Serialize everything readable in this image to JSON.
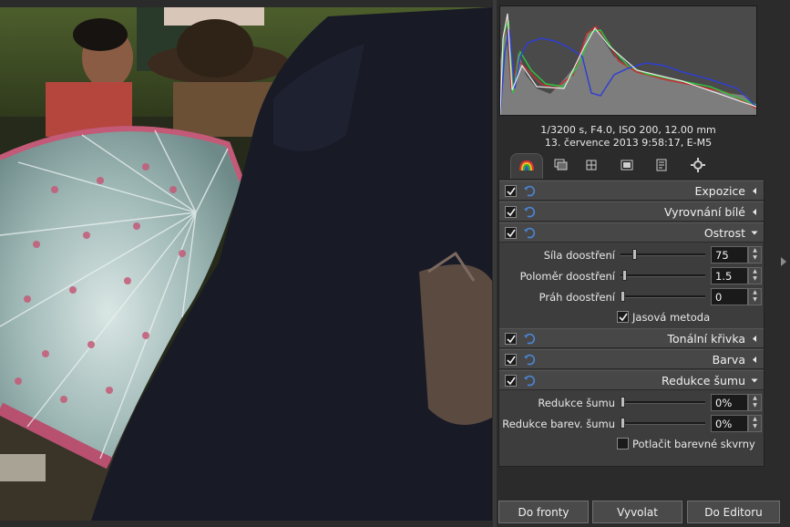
{
  "exif": {
    "line1": "1/3200 s, F4.0, ISO 200, 12.00 mm",
    "line2": "13. července 2013 9:58:17, E-M5"
  },
  "tabs": [
    {
      "name": "exposure-tab",
      "icon": "rainbow-icon",
      "active": true
    },
    {
      "name": "details-tab",
      "icon": "layers-icon"
    },
    {
      "name": "transform-tab",
      "icon": "crop-icon"
    },
    {
      "name": "raw-tab",
      "icon": "raw-film-icon"
    },
    {
      "name": "metadata-tab",
      "icon": "document-icon"
    },
    {
      "name": "color-management-tab",
      "icon": "gear-icon"
    }
  ],
  "sections": {
    "exposure": {
      "title": "Expozice"
    },
    "white_balance": {
      "title": "Vyrovnání bílé"
    },
    "sharpening": {
      "title": "Ostrost",
      "params": [
        {
          "label": "Síla doostření",
          "value": "75",
          "level": 0.15
        },
        {
          "label": "Poloměr doostření",
          "value": "1.5",
          "level": 0.02
        },
        {
          "label": "Práh doostření",
          "value": "0",
          "level": 0.0
        }
      ],
      "option_label": "Jasová metoda",
      "option_checked": true
    },
    "tone_curve": {
      "title": "Tonální křivka"
    },
    "color": {
      "title": "Barva"
    },
    "noise_reduction": {
      "title": "Redukce šumu",
      "params": [
        {
          "label": "Redukce šumu",
          "value": "0%",
          "level": 0.0
        },
        {
          "label": "Redukce barev. šumu",
          "value": "0%",
          "level": 0.0
        }
      ],
      "option_label": "Potlačit barevné skvrny",
      "option_checked": false
    }
  },
  "buttons": {
    "queue": "Do fronty",
    "develop": "Vyvolat",
    "editor": "Do Editoru"
  },
  "colors": {
    "accent_blue": "#4a86d8",
    "panel_bg": "#3d3d3d"
  }
}
